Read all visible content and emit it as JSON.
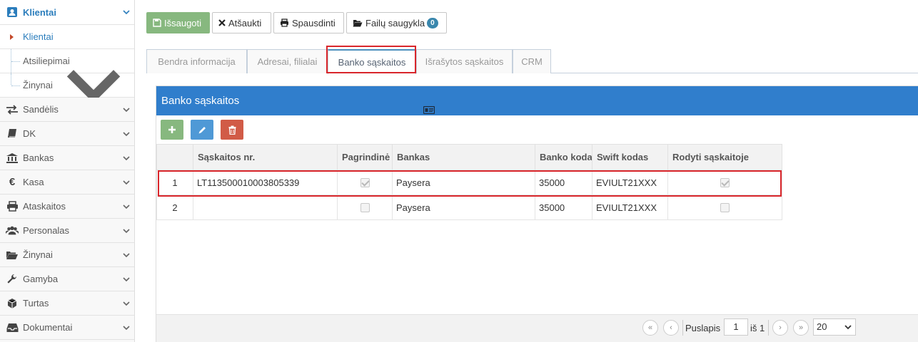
{
  "sidebar": {
    "section": {
      "label": "Klientai",
      "icon": "user-card-icon"
    },
    "sub_items": [
      {
        "label": "Klientai",
        "active": true
      },
      {
        "label": "Atsiliepimai"
      },
      {
        "label": "Žinynai",
        "has_children": true
      }
    ],
    "items": [
      {
        "label": "Sandėlis",
        "icon": "exchange-icon"
      },
      {
        "label": "DK",
        "icon": "book-icon"
      },
      {
        "label": "Bankas",
        "icon": "bank-icon"
      },
      {
        "label": "Kasa",
        "icon": "euro-icon"
      },
      {
        "label": "Ataskaitos",
        "icon": "printer-icon"
      },
      {
        "label": "Personalas",
        "icon": "users-icon"
      },
      {
        "label": "Žinynai",
        "icon": "folder-open-icon"
      },
      {
        "label": "Gamyba",
        "icon": "wrench-icon"
      },
      {
        "label": "Turtas",
        "icon": "cube-icon"
      },
      {
        "label": "Dokumentai",
        "icon": "inbox-icon"
      }
    ]
  },
  "toolbar": {
    "save": "Išsaugoti",
    "cancel": "Atšaukti",
    "print": "Spausdinti",
    "files": "Failų saugykla",
    "files_count": "0"
  },
  "tabs": [
    {
      "label": "Bendra informacija"
    },
    {
      "label": "Adresai, filialai"
    },
    {
      "label": "Banko sąskaitos",
      "active": true
    },
    {
      "label": "Išrašytos sąskaitos"
    },
    {
      "label": "CRM"
    }
  ],
  "panel": {
    "title": "Banko sąskaitos",
    "columns": [
      "Sąskaitos nr.",
      "Pagrindinė",
      "Bankas",
      "Banko kodas",
      "Swift kodas",
      "Rodyti sąskaitoje"
    ],
    "rows": [
      {
        "n": "1",
        "account": "LT113500010003805339",
        "primary": true,
        "bank": "Paysera",
        "code": "35000",
        "swift": "EVIULT21XXX",
        "show": true
      },
      {
        "n": "2",
        "account": "",
        "primary": false,
        "bank": "Paysera",
        "code": "35000",
        "swift": "EVIULT21XXX",
        "show": false
      }
    ]
  },
  "pager": {
    "page_label": "Puslapis",
    "page": "1",
    "of_label": "iš 1",
    "page_size": "20"
  },
  "colors": {
    "header_blue": "#307ecc",
    "save_green": "#87b87f",
    "add_green": "#87b87f",
    "edit_blue": "#6fb3e0",
    "delete_red": "#d15b47",
    "highlight_red": "#d9262b"
  }
}
